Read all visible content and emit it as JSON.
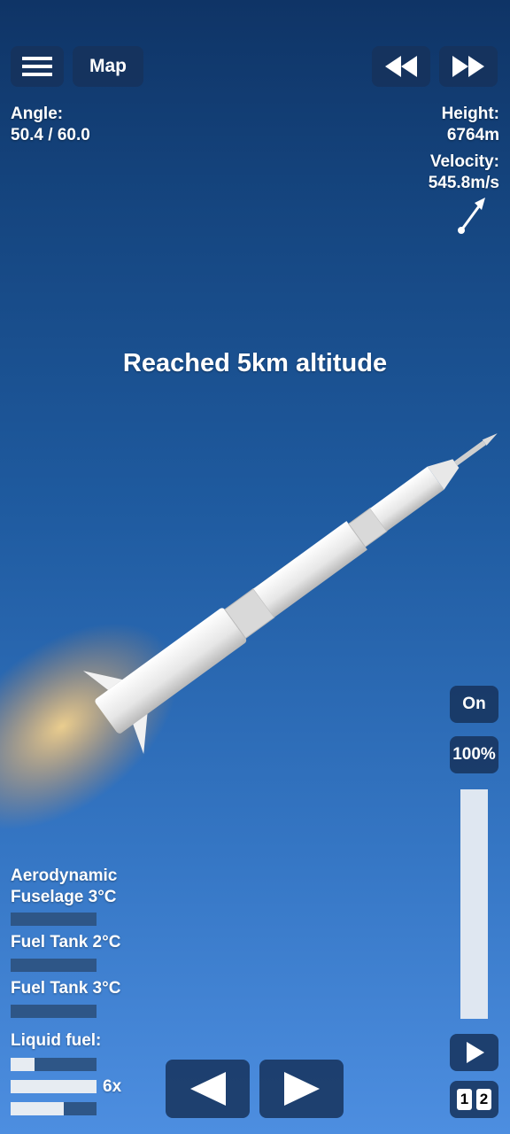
{
  "top_bar": {
    "menu_icon": "hamburger-menu-icon",
    "map_label": "Map",
    "rewind_icon": "rewind-icon",
    "fast_forward_icon": "fast-forward-icon"
  },
  "angle": {
    "label": "Angle:",
    "value": "50.4 / 60.0"
  },
  "height": {
    "label": "Height:",
    "value": "6764m"
  },
  "velocity": {
    "label": "Velocity:",
    "value": "545.8m/s",
    "arrow_icon": "velocity-direction-arrow-icon"
  },
  "notification": "Reached 5km altitude",
  "right_panel": {
    "toggle_label": "On",
    "throttle_label": "100%",
    "throttle_level": 1.0,
    "play_icon": "play-icon",
    "stage_1": "1",
    "stage_2": "2"
  },
  "temperatures": [
    {
      "name": "Aerodynamic\nFuselage 3°C",
      "level": 0.0
    },
    {
      "name": "Fuel Tank 2°C",
      "level": 0.0
    },
    {
      "name": "Fuel Tank 3°C",
      "level": 0.0
    }
  ],
  "fuel": {
    "label": "Liquid fuel:",
    "bars": [
      0.28,
      1.0,
      0.62
    ],
    "multiplier": "6x"
  },
  "controls": {
    "rotate_left_icon": "rotate-left-arrow-icon",
    "rotate_right_icon": "rotate-right-arrow-icon"
  },
  "colors": {
    "panel": "#16325c",
    "bar_bg": "#2e5687",
    "bar_fill": "#e7ecf2",
    "flame": "#ffd27a"
  }
}
